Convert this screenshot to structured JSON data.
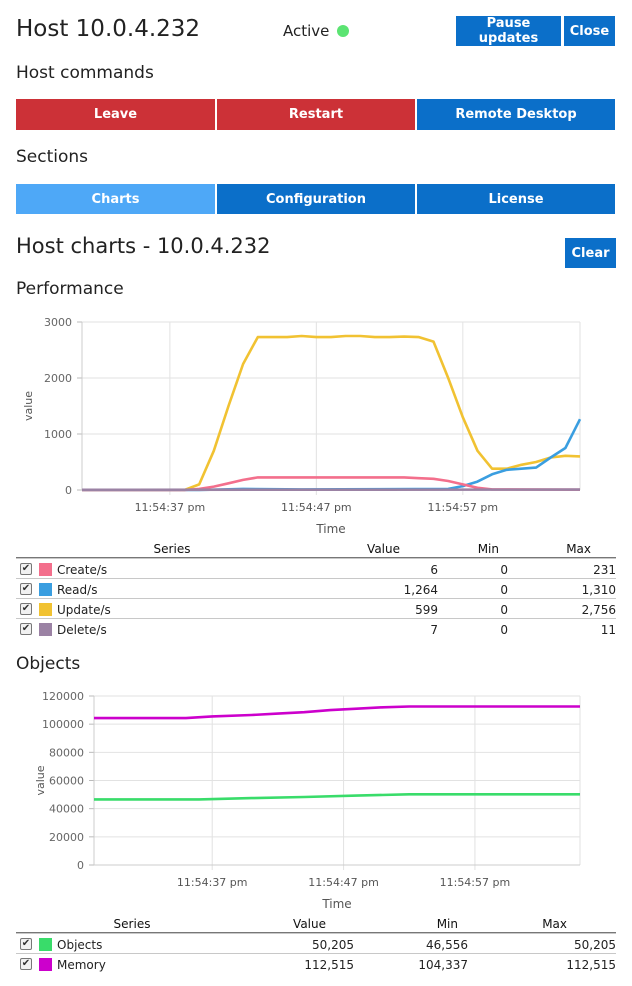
{
  "header": {
    "title": "Host 10.0.4.232",
    "status_label": "Active",
    "pause_label": "Pause updates",
    "close_label": "Close",
    "status_color": "#5be472"
  },
  "commands": {
    "heading": "Host commands",
    "leave_label": "Leave",
    "restart_label": "Restart",
    "remote_label": "Remote Desktop"
  },
  "sections": {
    "heading": "Sections",
    "tabs": [
      {
        "label": "Charts",
        "active": true
      },
      {
        "label": "Configuration",
        "active": false
      },
      {
        "label": "License",
        "active": false
      }
    ]
  },
  "host_charts": {
    "title": "Host charts - 10.0.4.232",
    "clear_label": "Clear"
  },
  "performance": {
    "heading": "Performance",
    "table_headers": [
      "Series",
      "Value",
      "Min",
      "Max"
    ],
    "rows": [
      {
        "name": "Create/s",
        "value": "6",
        "min": "0",
        "max": "231",
        "color": "#f36f8c",
        "checked": true
      },
      {
        "name": "Read/s",
        "value": "1,264",
        "min": "0",
        "max": "1,310",
        "color": "#3a9ee0",
        "checked": true
      },
      {
        "name": "Update/s",
        "value": "599",
        "min": "0",
        "max": "2,756",
        "color": "#f1c232",
        "checked": true
      },
      {
        "name": "Delete/s",
        "value": "7",
        "min": "0",
        "max": "11",
        "color": "#9b82a4",
        "checked": true
      }
    ]
  },
  "objects": {
    "heading": "Objects",
    "table_headers": [
      "Series",
      "Value",
      "Min",
      "Max"
    ],
    "rows": [
      {
        "name": "Objects",
        "value": "50,205",
        "min": "46,556",
        "max": "50,205",
        "color": "#39dc6a",
        "checked": true
      },
      {
        "name": "Memory",
        "value": "112,515",
        "min": "104,337",
        "max": "112,515",
        "color": "#cc00cc",
        "checked": true
      }
    ]
  },
  "chart_data": [
    {
      "type": "line",
      "title": "",
      "xlabel": "Time",
      "ylabel": "value",
      "ylim": [
        0,
        3000
      ],
      "yticks": [
        0,
        1000,
        2000,
        3000
      ],
      "ytick_labels": [
        "0",
        "1000",
        "2000",
        "3000"
      ],
      "x_range": [
        "11:54:31",
        "11:55:05"
      ],
      "xtick_labels": [
        "11:54:37 pm",
        "11:54:47 pm",
        "11:54:57 pm"
      ],
      "xticks": [
        "11:54:37",
        "11:54:47",
        "11:54:57"
      ],
      "grid": true,
      "series": [
        {
          "name": "Update/s",
          "color": "#f1c232",
          "x": [
            "11:54:31",
            "11:54:38",
            "11:54:39",
            "11:54:40",
            "11:54:41",
            "11:54:42",
            "11:54:43",
            "11:54:44",
            "11:54:45",
            "11:54:46",
            "11:54:47",
            "11:54:48",
            "11:54:49",
            "11:54:50",
            "11:54:51",
            "11:54:52",
            "11:54:53",
            "11:54:54",
            "11:54:55",
            "11:54:56",
            "11:54:57",
            "11:54:58",
            "11:54:59",
            "11:55:00",
            "11:55:01",
            "11:55:02",
            "11:55:03",
            "11:55:04",
            "11:55:05"
          ],
          "y": [
            0,
            0,
            100,
            700,
            1500,
            2250,
            2730,
            2730,
            2730,
            2750,
            2730,
            2730,
            2750,
            2750,
            2730,
            2730,
            2740,
            2730,
            2650,
            2000,
            1300,
            700,
            380,
            380,
            450,
            500,
            580,
            610,
            600
          ]
        },
        {
          "name": "Read/s",
          "color": "#3a9ee0",
          "x": [
            "11:54:31",
            "11:54:39",
            "11:54:42",
            "11:54:46",
            "11:54:56",
            "11:54:57",
            "11:54:58",
            "11:54:59",
            "11:55:00",
            "11:55:01",
            "11:55:02",
            "11:55:03",
            "11:55:04",
            "11:55:05"
          ],
          "y": [
            0,
            0,
            20,
            10,
            20,
            70,
            150,
            280,
            360,
            380,
            400,
            580,
            750,
            1264
          ],
          "y_note": ""
        },
        {
          "name": "Create/s",
          "color": "#f36f8c",
          "x": [
            "11:54:31",
            "11:54:38",
            "11:54:39",
            "11:54:40",
            "11:54:41",
            "11:54:42",
            "11:54:43",
            "11:54:53",
            "11:54:54",
            "11:54:55",
            "11:54:56",
            "11:54:57",
            "11:54:58",
            "11:54:59",
            "11:55:05"
          ],
          "y": [
            0,
            0,
            20,
            60,
            120,
            180,
            225,
            225,
            210,
            200,
            160,
            100,
            40,
            10,
            6
          ]
        },
        {
          "name": "Delete/s",
          "color": "#9b82a4",
          "x": [
            "11:54:31",
            "11:55:05"
          ],
          "y": [
            3,
            7
          ]
        }
      ]
    },
    {
      "type": "line",
      "title": "",
      "xlabel": "Time",
      "ylabel": "value",
      "ylim": [
        0,
        120000
      ],
      "yticks": [
        0,
        20000,
        40000,
        60000,
        80000,
        100000,
        120000
      ],
      "ytick_labels": [
        "0",
        "20000",
        "40000",
        "60000",
        "80000",
        "100000",
        "120000"
      ],
      "x_range": [
        "11:54:28",
        "11:55:05"
      ],
      "xtick_labels": [
        "11:54:37 pm",
        "11:54:47 pm",
        "11:54:57 pm"
      ],
      "xticks": [
        "11:54:37",
        "11:54:47",
        "11:54:57"
      ],
      "grid": true,
      "series": [
        {
          "name": "Memory",
          "color": "#cc00cc",
          "x": [
            "11:54:28",
            "11:54:35",
            "11:54:37",
            "11:54:40",
            "11:54:42",
            "11:54:44",
            "11:54:46",
            "11:54:48",
            "11:54:50",
            "11:54:52",
            "11:55:05"
          ],
          "y": [
            104337,
            104337,
            105500,
            106500,
            107500,
            108500,
            110000,
            111000,
            112000,
            112515,
            112515
          ]
        },
        {
          "name": "Objects",
          "color": "#39dc6a",
          "x": [
            "11:54:28",
            "11:54:36",
            "11:54:40",
            "11:54:44",
            "11:54:48",
            "11:54:52",
            "11:55:05"
          ],
          "y": [
            46556,
            46556,
            47500,
            48300,
            49300,
            50205,
            50205
          ]
        }
      ]
    }
  ]
}
